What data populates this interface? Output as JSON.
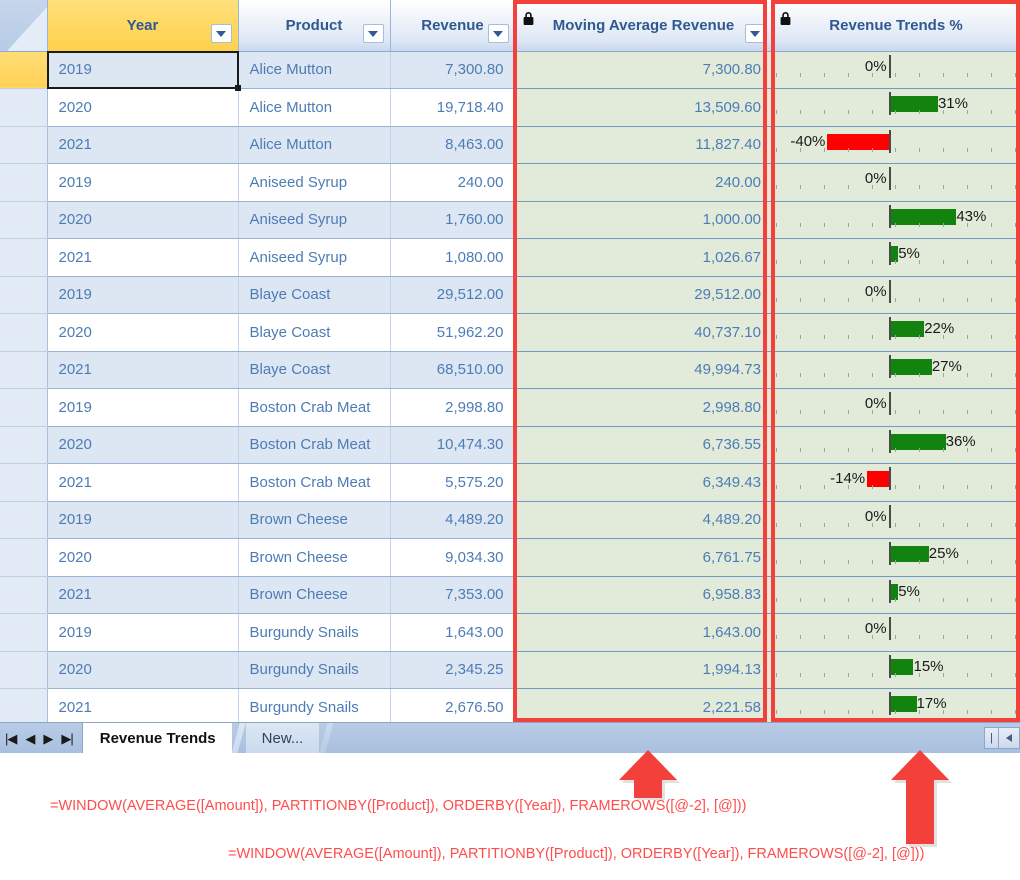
{
  "app": {
    "title": "Revenue Trends"
  },
  "grid": {
    "corner_name": "select-all-corner",
    "columns": [
      {
        "key": "year",
        "label": "Year",
        "align": "left",
        "filter": true,
        "locked": false,
        "highlight": true
      },
      {
        "key": "prod",
        "label": "Product",
        "align": "left",
        "filter": true,
        "locked": false,
        "highlight": false
      },
      {
        "key": "rev",
        "label": "Revenue",
        "align": "right",
        "filter": true,
        "locked": false,
        "highlight": false
      },
      {
        "key": "mavg",
        "label": "Moving Average Revenue",
        "align": "right",
        "filter": true,
        "locked": true,
        "highlight": false
      },
      {
        "key": "trend",
        "label": "Revenue Trends %",
        "align": "center",
        "filter": false,
        "locked": true,
        "highlight": false
      }
    ],
    "rows": [
      {
        "year": "2019",
        "product": "Alice Mutton",
        "revenue": "7,300.80",
        "moving_average": "7,300.80",
        "trend_label": "0%",
        "trend_value": 0
      },
      {
        "year": "2020",
        "product": "Alice Mutton",
        "revenue": "19,718.40",
        "moving_average": "13,509.60",
        "trend_label": "31%",
        "trend_value": 31
      },
      {
        "year": "2021",
        "product": "Alice Mutton",
        "revenue": "8,463.00",
        "moving_average": "11,827.40",
        "trend_label": "-40%",
        "trend_value": -40
      },
      {
        "year": "2019",
        "product": "Aniseed Syrup",
        "revenue": "240.00",
        "moving_average": "240.00",
        "trend_label": "0%",
        "trend_value": 0
      },
      {
        "year": "2020",
        "product": "Aniseed Syrup",
        "revenue": "1,760.00",
        "moving_average": "1,000.00",
        "trend_label": "43%",
        "trend_value": 43
      },
      {
        "year": "2021",
        "product": "Aniseed Syrup",
        "revenue": "1,080.00",
        "moving_average": "1,026.67",
        "trend_label": "5%",
        "trend_value": 5
      },
      {
        "year": "2019",
        "product": "Blaye Coast",
        "revenue": "29,512.00",
        "moving_average": "29,512.00",
        "trend_label": "0%",
        "trend_value": 0
      },
      {
        "year": "2020",
        "product": "Blaye Coast",
        "revenue": "51,962.20",
        "moving_average": "40,737.10",
        "trend_label": "22%",
        "trend_value": 22
      },
      {
        "year": "2021",
        "product": "Blaye Coast",
        "revenue": "68,510.00",
        "moving_average": "49,994.73",
        "trend_label": "27%",
        "trend_value": 27
      },
      {
        "year": "2019",
        "product": "Boston Crab Meat",
        "revenue": "2,998.80",
        "moving_average": "2,998.80",
        "trend_label": "0%",
        "trend_value": 0
      },
      {
        "year": "2020",
        "product": "Boston Crab Meat",
        "revenue": "10,474.30",
        "moving_average": "6,736.55",
        "trend_label": "36%",
        "trend_value": 36
      },
      {
        "year": "2021",
        "product": "Boston Crab Meat",
        "revenue": "5,575.20",
        "moving_average": "6,349.43",
        "trend_label": "-14%",
        "trend_value": -14
      },
      {
        "year": "2019",
        "product": "Brown Cheese",
        "revenue": "4,489.20",
        "moving_average": "4,489.20",
        "trend_label": "0%",
        "trend_value": 0
      },
      {
        "year": "2020",
        "product": "Brown Cheese",
        "revenue": "9,034.30",
        "moving_average": "6,761.75",
        "trend_label": "25%",
        "trend_value": 25
      },
      {
        "year": "2021",
        "product": "Brown Cheese",
        "revenue": "7,353.00",
        "moving_average": "6,958.83",
        "trend_label": "5%",
        "trend_value": 5
      },
      {
        "year": "2019",
        "product": "Burgundy Snails",
        "revenue": "1,643.00",
        "moving_average": "1,643.00",
        "trend_label": "0%",
        "trend_value": 0
      },
      {
        "year": "2020",
        "product": "Burgundy Snails",
        "revenue": "2,345.25",
        "moving_average": "1,994.13",
        "trend_label": "15%",
        "trend_value": 15
      },
      {
        "year": "2021",
        "product": "Burgundy Snails",
        "revenue": "2,676.50",
        "moving_average": "2,221.58",
        "trend_label": "17%",
        "trend_value": 17
      }
    ],
    "selected_cell": {
      "row": 0,
      "column": "year",
      "value": "2019"
    }
  },
  "tabbar": {
    "nav_first": "|◀",
    "nav_prev": "◀",
    "nav_next": "▶",
    "nav_last": "▶|",
    "tabs": [
      {
        "label": "Revenue Trends",
        "active": true
      },
      {
        "label": "New...",
        "active": false
      }
    ]
  },
  "annotations": {
    "formula_1": "=WINDOW(AVERAGE([Amount]), PARTITIONBY([Product]), ORDERBY([Year]), FRAMEROWS([@-2], [@]))",
    "formula_2": "=WINDOW(AVERAGE([Amount]), PARTITIONBY([Product]), ORDERBY([Year]), FRAMEROWS([@-2], [@]))",
    "arrow_1_name": "arrow-to-moving-average-column",
    "arrow_2_name": "arrow-to-revenue-trends-column"
  },
  "colors": {
    "accent_red": "#f4403a",
    "bar_positive": "#13830f",
    "bar_negative": "#ff0000",
    "header_text": "#31588f",
    "cell_text": "#4d7cb5",
    "locked_column_bg": "#e2ebda",
    "year_header_bg": "#ffd966"
  },
  "databar": {
    "axis_percent": 47,
    "max_scale": 60,
    "tick_count": 11
  }
}
